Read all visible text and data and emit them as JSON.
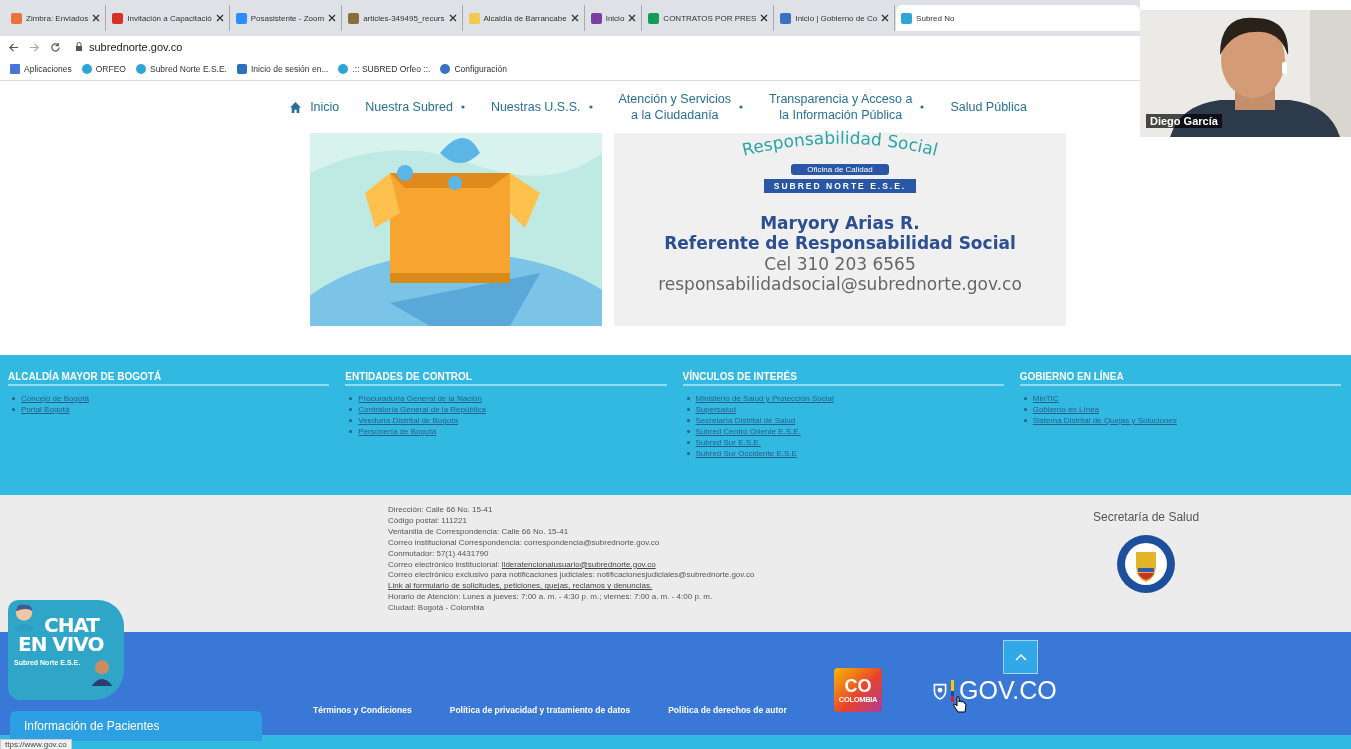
{
  "browser": {
    "tabs": [
      {
        "title": "Zimbra: Enviados",
        "selected": false,
        "color": "#e8743b"
      },
      {
        "title": "Invitación a Capacitació",
        "selected": false,
        "color": "#d93025"
      },
      {
        "title": "Posasistente - Zoom",
        "selected": false,
        "color": "#2d8cff"
      },
      {
        "title": "articles-349495_recurs",
        "selected": false,
        "color": "#8a6d3b"
      },
      {
        "title": "Alcaldía de Barrancabe",
        "selected": false,
        "color": "#f2c94c"
      },
      {
        "title": "Inicio",
        "selected": false,
        "color": "#7b3fa0"
      },
      {
        "title": "CONTRATOS POR PRES",
        "selected": false,
        "color": "#0f9d58"
      },
      {
        "title": "Inicio | Gobierno de Co",
        "selected": false,
        "color": "#3b6fc4"
      },
      {
        "title": "Subred No",
        "selected": true,
        "color": "#2fa4d8"
      }
    ],
    "address": "subrednorte.gov.co",
    "bookmarks": [
      "Aplicaciones",
      "ORFEO",
      "Subred Norte E.S.E.",
      "Inicio de sesión en...",
      ".:: SUBRED Orfeo ::.",
      "Configuración"
    ]
  },
  "nav": [
    {
      "label": "Inicio",
      "dropdown": false
    },
    {
      "label": "Nuestra Subred",
      "dropdown": true
    },
    {
      "label": "Nuestras U.S.S.",
      "dropdown": true
    },
    {
      "label": "Atención y Servicios\na la Ciudadanía",
      "dropdown": true
    },
    {
      "label": "Transparencia y Acceso a\nla Información Pública",
      "dropdown": true
    },
    {
      "label": "Salud Pública",
      "dropdown": false
    }
  ],
  "banner": {
    "heading": "Responsabilidad Social",
    "office": "Oficina de Calidad",
    "org": "SUBRED NORTE E.S.E.",
    "name": "Maryory Arias R.",
    "role": "Referente de Responsabilidad Social",
    "phone": "Cel 310 203 6565",
    "email": "responsabilidadsocial@subrednorte.gov.co"
  },
  "footer_columns": [
    {
      "heading": "ALCALDÍA MAYOR DE BOGOTÁ",
      "links": [
        "Concejo de Bogotá",
        "Portal Bogotá"
      ]
    },
    {
      "heading": "ENTIDADES DE CONTROL",
      "links": [
        "Procuraduría General de la Nación",
        "Contraloría General de la República",
        "Veeduría Distrital de Bogota",
        "Personería de Bogotá"
      ]
    },
    {
      "heading": "VÍNCULOS DE INTERÉS",
      "links": [
        "Ministerio de Salud y Protección Social",
        "Supersalud",
        "Secretaría Distrital de Salud",
        "Subred Centro Oriente E.S.E.",
        "Subred Sur E.S.E.",
        "Subred Sur Occidente E.S.E"
      ]
    },
    {
      "heading": "GOBIERNO EN LÍNEA",
      "links": [
        "MinTIC",
        "Gobierno en Línea",
        "Sistema Distrital de Quejas y Soluciones"
      ]
    }
  ],
  "contact": [
    {
      "kind": "text",
      "text": "Dirección: Calle 66 No. 15-41"
    },
    {
      "kind": "text",
      "text": "Código postal: 111221"
    },
    {
      "kind": "text",
      "text": "Ventanilla de Correspondencia: Calle 66 No. 15-41"
    },
    {
      "kind": "text",
      "text": "Correo institucional Correspondencia: correspondencia@subrednorte.gov.co"
    },
    {
      "kind": "text",
      "text": "Conmutador: 57(1) 4431790"
    },
    {
      "kind": "mixed",
      "text": "Correo electrónico institucional: ",
      "link": "lideratencionalusuario@subrednorte.gov.co"
    },
    {
      "kind": "text",
      "text": "Correo electrónico exclusivo para notificaciones judiciales: notificacionesjudiciales@subrednorte.gov.co"
    },
    {
      "kind": "link",
      "text": "Link al formulario de solicitudes, peticiones, quejas, reclamos y denuncias."
    },
    {
      "kind": "text",
      "text": "Horario de Atención: Lunes a jueves: 7:00 a. m. - 4:30 p. m.; viernes: 7:00 a. m. - 4:00 p. m."
    },
    {
      "kind": "text",
      "text": "Ciudad: Bogotá - Colombia"
    }
  ],
  "secretaria": "Secretaría de Salud",
  "bottom_links": [
    "Términos y Condiciones",
    "Política de privacidad y tratamiento de datos",
    "Política de derechos de autor"
  ],
  "co_badge": {
    "big": "CO",
    "small": "COLOMBIA"
  },
  "gov": "GOV.CO",
  "chat": {
    "line1": "CHAT",
    "line2": "EN VIVO",
    "line3": "Subred Norte E.S.E."
  },
  "info_tab": "Información de Pacientes",
  "status_url": "ttps://www.gov.co",
  "video": {
    "name": "Diego García"
  }
}
